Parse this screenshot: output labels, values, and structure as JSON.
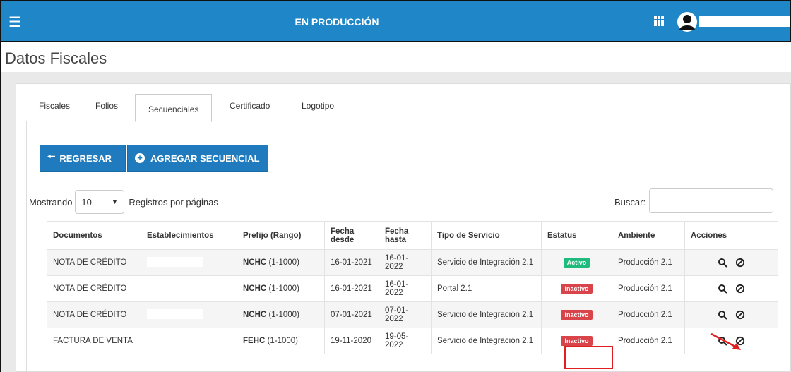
{
  "header": {
    "env_title": "EN PRODUCCIÓN"
  },
  "page": {
    "title": "Datos Fiscales"
  },
  "tabs": [
    "Fiscales",
    "Folios",
    "Secuenciales",
    "Certificado",
    "Logotipo"
  ],
  "buttons": {
    "back": "REGRESAR",
    "add": "AGREGAR SECUENCIAL"
  },
  "list_controls": {
    "showing": "Mostrando",
    "page_size": "10",
    "per_page_label": "Registros por páginas",
    "search_label": "Buscar:"
  },
  "table": {
    "headers": [
      "Documentos",
      "Establecimientos",
      "Prefijo (Rango)",
      "Fecha desde",
      "Fecha hasta",
      "Tipo de Servicio",
      "Estatus",
      "Ambiente",
      "Acciones"
    ],
    "rows": [
      {
        "documento": "NOTA DE CRÉDITO",
        "prefijo": "NCHC",
        "rango": "(1-1000)",
        "desde": "16-01-2021",
        "hasta": "16-01-2022",
        "servicio": "Servicio de Integración 2.1",
        "estatus": "Activo",
        "ambiente": "Producción 2.1"
      },
      {
        "documento": "NOTA DE CRÉDITO",
        "prefijo": "NCHC",
        "rango": "(1-1000)",
        "desde": "16-01-2021",
        "hasta": "16-01-2022",
        "servicio": "Portal 2.1",
        "estatus": "Inactivo",
        "ambiente": "Producción 2.1"
      },
      {
        "documento": "NOTA DE CRÉDITO",
        "prefijo": "NCHC",
        "rango": "(1-1000)",
        "desde": "07-01-2021",
        "hasta": "07-01-2022",
        "servicio": "Servicio de Integración 2.1",
        "estatus": "Inactivo",
        "ambiente": "Producción 2.1"
      },
      {
        "documento": "FACTURA DE VENTA",
        "prefijo": "FEHC",
        "rango": "(1-1000)",
        "desde": "19-11-2020",
        "hasta": "19-05-2022",
        "servicio": "Servicio de Integración 2.1",
        "estatus": "Inactivo",
        "ambiente": "Producción 2.1"
      }
    ]
  },
  "colors": {
    "header_bg": "#1f86c8",
    "button_bg": "#1f7bbd",
    "badge_active": "#1fbb7d",
    "badge_inactive": "#d9434a",
    "annotation": "#e02020"
  }
}
